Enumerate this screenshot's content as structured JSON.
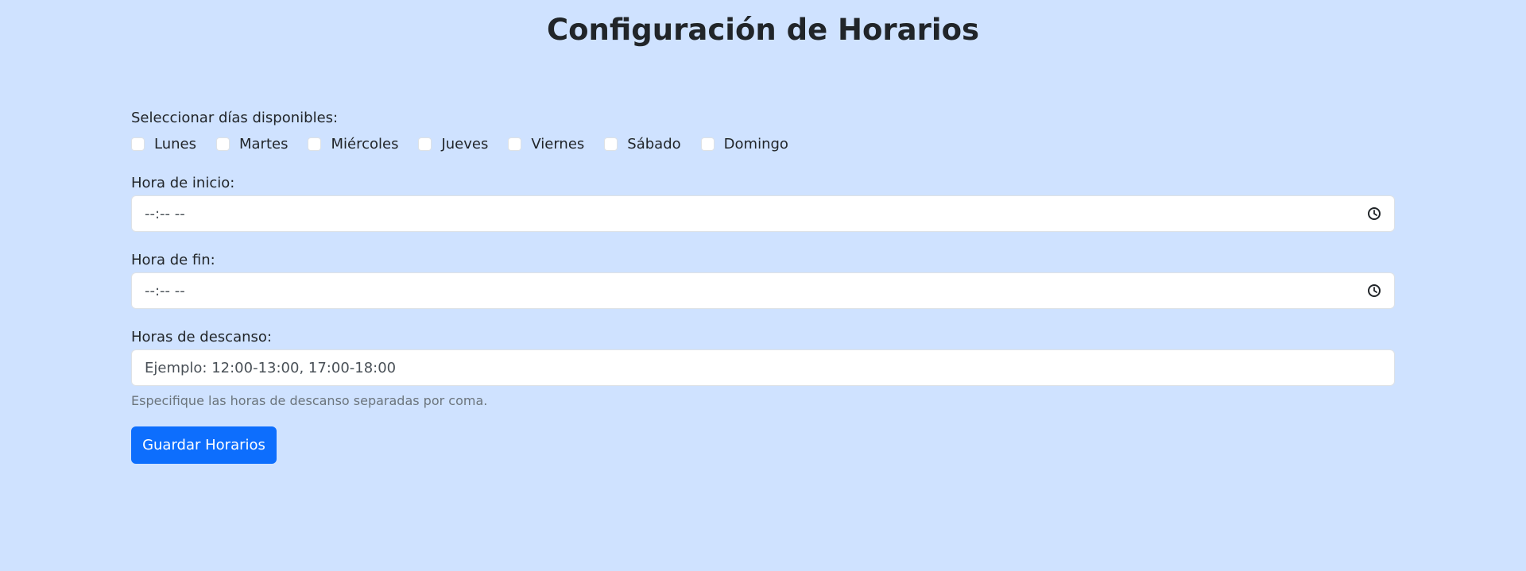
{
  "page": {
    "title": "Configuración de Horarios"
  },
  "days": {
    "label": "Seleccionar días disponibles:",
    "items": [
      {
        "label": "Lunes",
        "checked": false
      },
      {
        "label": "Martes",
        "checked": false
      },
      {
        "label": "Miércoles",
        "checked": false
      },
      {
        "label": "Jueves",
        "checked": false
      },
      {
        "label": "Viernes",
        "checked": false
      },
      {
        "label": "Sábado",
        "checked": false
      },
      {
        "label": "Domingo",
        "checked": false
      }
    ]
  },
  "start_time": {
    "label": "Hora de inicio:",
    "value": "--:-- --",
    "icon": "clock-icon"
  },
  "end_time": {
    "label": "Hora de fin:",
    "value": "--:-- --",
    "icon": "clock-icon"
  },
  "breaks": {
    "label": "Horas de descanso:",
    "placeholder": "Ejemplo: 12:00-13:00, 17:00-18:00",
    "help": "Especifique las horas de descanso separadas por coma."
  },
  "submit": {
    "label": "Guardar Horarios"
  },
  "colors": {
    "background": "#cfe2ff",
    "primary": "#0d6efd",
    "input_bg": "#ffffff",
    "muted_text": "#6c757d"
  }
}
